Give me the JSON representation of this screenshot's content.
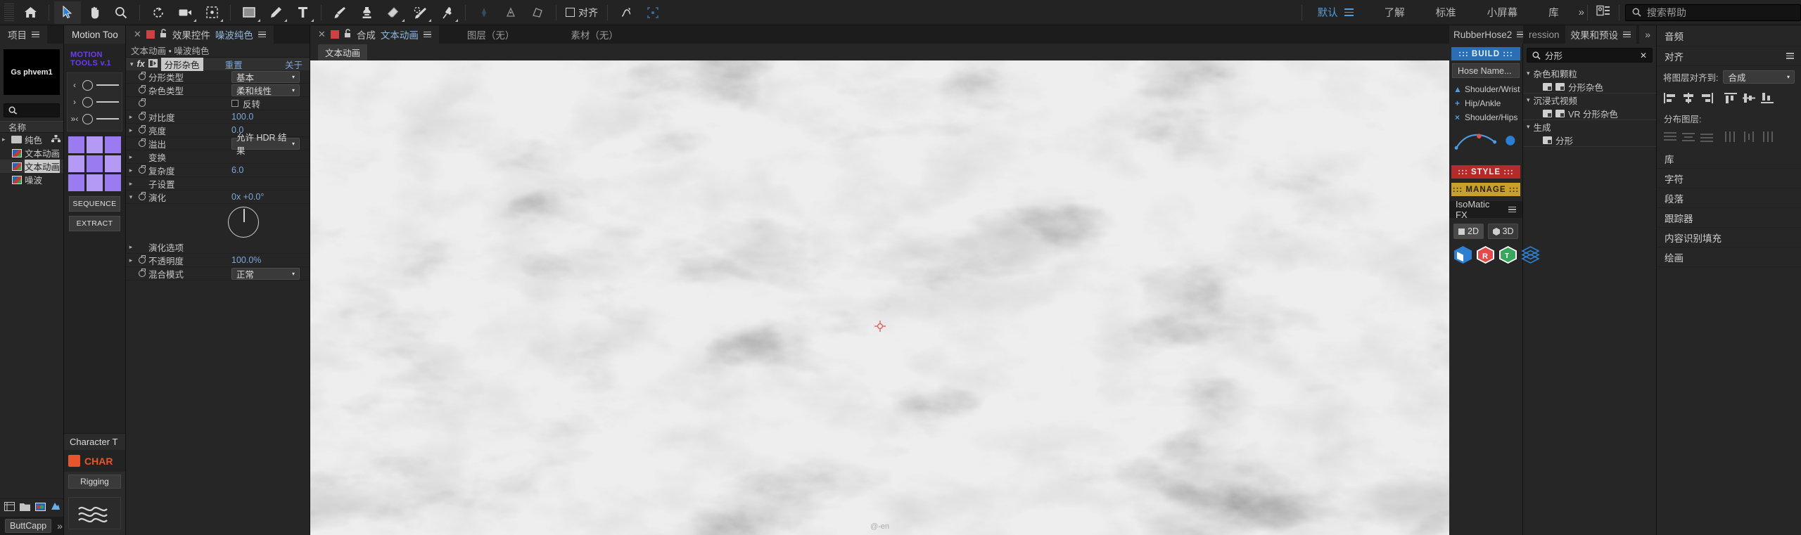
{
  "toolbar": {
    "tools": [
      {
        "name": "home-icon",
        "title": "主页"
      },
      {
        "name": "selection-tool-icon",
        "title": "选取工具"
      },
      {
        "name": "hand-tool-icon",
        "title": "手形工具"
      },
      {
        "name": "zoom-tool-icon",
        "title": "缩放工具"
      },
      {
        "name": "rotation-tool-icon",
        "title": "旋转工具"
      },
      {
        "name": "camera-tool-icon",
        "title": "摄像机工具"
      },
      {
        "name": "anchor-point-tool-icon",
        "title": "向后平移工具"
      },
      {
        "name": "shape-tool-icon",
        "title": "形状工具"
      },
      {
        "name": "pen-tool-icon",
        "title": "钢笔工具"
      },
      {
        "name": "type-tool-icon",
        "title": "文字工具"
      },
      {
        "name": "brush-tool-icon",
        "title": "画笔工具"
      },
      {
        "name": "clone-stamp-tool-icon",
        "title": "仿制图章工具"
      },
      {
        "name": "eraser-tool-icon",
        "title": "橡皮擦工具"
      },
      {
        "name": "roto-brush-tool-icon",
        "title": "Roto 笔刷工具"
      },
      {
        "name": "puppet-pin-tool-icon",
        "title": "人偶位置控点工具"
      }
    ],
    "snap_label": "对齐",
    "workspaces": [
      {
        "label": "默认",
        "active": true
      },
      {
        "label": "了解",
        "active": false
      },
      {
        "label": "标准",
        "active": false
      },
      {
        "label": "小屏幕",
        "active": false
      },
      {
        "label": "库",
        "active": false
      }
    ],
    "overflow_label": "»",
    "help_placeholder": "搜索帮助"
  },
  "project": {
    "tab_label": "项目",
    "thumb_text": "Gs phvem1",
    "search_placeholder": "",
    "column_header": "名称",
    "items": [
      {
        "label": "纯色",
        "type": "folder",
        "selected": false
      },
      {
        "label": "文本动画",
        "type": "comp",
        "selected": false
      },
      {
        "label": "文本动画",
        "type": "comp",
        "selected": true
      },
      {
        "label": "噪波",
        "type": "comp",
        "selected": false
      }
    ],
    "bottom_button": "ButtCapp",
    "bottom_overflow": "»"
  },
  "motion_tools": {
    "tab_label": "Motion Too",
    "logo_line1": "MOTION",
    "logo_line2": "TOOLS v.1",
    "rows": [
      "‹",
      "›",
      "»‹"
    ],
    "sequence_button": "SEQUENCE",
    "extract_button": "EXTRACT",
    "character_label": "Character T",
    "char_brand": "CHAR",
    "rigging_button": "Rigging"
  },
  "effect_controls": {
    "tab_label": "效果控件",
    "tab_layer": "噪波纯色",
    "breadcrumb": "文本动画 • 噪波纯色",
    "effect_name": "分形杂色",
    "reset_label": "重置",
    "about_label": "关于",
    "properties": [
      {
        "label": "分形类型",
        "value": "基本",
        "kind": "select",
        "indent": 2
      },
      {
        "label": "杂色类型",
        "value": "柔和线性",
        "kind": "select",
        "indent": 2
      },
      {
        "label": "反转",
        "value": "",
        "kind": "checkbox",
        "indent": 2
      },
      {
        "label": "对比度",
        "value": "100.0",
        "kind": "number",
        "indent": 1
      },
      {
        "label": "亮度",
        "value": "0.0",
        "kind": "number",
        "indent": 1
      },
      {
        "label": "溢出",
        "value": "允许 HDR 结果",
        "kind": "select",
        "indent": 2
      },
      {
        "label": "变换",
        "value": "",
        "kind": "group",
        "indent": 1
      },
      {
        "label": "复杂度",
        "value": "6.0",
        "kind": "number",
        "indent": 1
      },
      {
        "label": "子设置",
        "value": "",
        "kind": "group",
        "indent": 1
      },
      {
        "label": "演化",
        "value": "0x +0.0°",
        "kind": "angle",
        "indent": 1
      },
      {
        "label": "演化选项",
        "value": "",
        "kind": "group",
        "indent": 1
      },
      {
        "label": "不透明度",
        "value": "100.0%",
        "kind": "number",
        "indent": 1
      },
      {
        "label": "混合模式",
        "value": "正常",
        "kind": "select",
        "indent": 2
      }
    ]
  },
  "composition": {
    "tab_label": "合成",
    "tab_name": "文本动画",
    "tab_layer": "图层（无）",
    "tab_footage": "素材（无）",
    "comp_name_chip": "文本动画",
    "watermark": "@-en"
  },
  "rubberhose": {
    "tab_label": "RubberHose2",
    "build_label": "::: BUILD :::",
    "hose_name_placeholder": "Hose Name...",
    "joints": [
      {
        "key": "▲",
        "label": "Shoulder/Wrist"
      },
      {
        "key": "+",
        "label": "Hip/Ankle"
      },
      {
        "key": "×",
        "label": "Shoulder/Hips"
      }
    ],
    "style_label": "::: STYLE :::",
    "manage_label": "::: MANAGE :::",
    "iso_tab": "IsoMatic FX",
    "mode_2d": "2D",
    "mode_3d": "3D"
  },
  "effects_presets": {
    "tab_inactive": "ression",
    "tab_label": "效果和预设",
    "overflow": "»",
    "search_value": "分形",
    "tree": [
      {
        "label": "杂色和颗粒",
        "kind": "group",
        "indent": 0
      },
      {
        "label": "分形杂色",
        "kind": "effect",
        "indent": 1
      },
      {
        "label": "沉浸式视频",
        "kind": "group",
        "indent": 0
      },
      {
        "label": "VR 分形杂色",
        "kind": "effect",
        "indent": 1
      },
      {
        "label": "生成",
        "kind": "group",
        "indent": 0
      },
      {
        "label": "分形",
        "kind": "effect",
        "indent": 1
      }
    ]
  },
  "right_rail": {
    "audio_label": "音频",
    "align_tab": "对齐",
    "align_to_label": "将图层对齐到:",
    "align_to_value": "合成",
    "distribute_label": "分布图层:",
    "sections": [
      "库",
      "字符",
      "段落",
      "跟踪器",
      "内容识别填充",
      "绘画"
    ]
  }
}
